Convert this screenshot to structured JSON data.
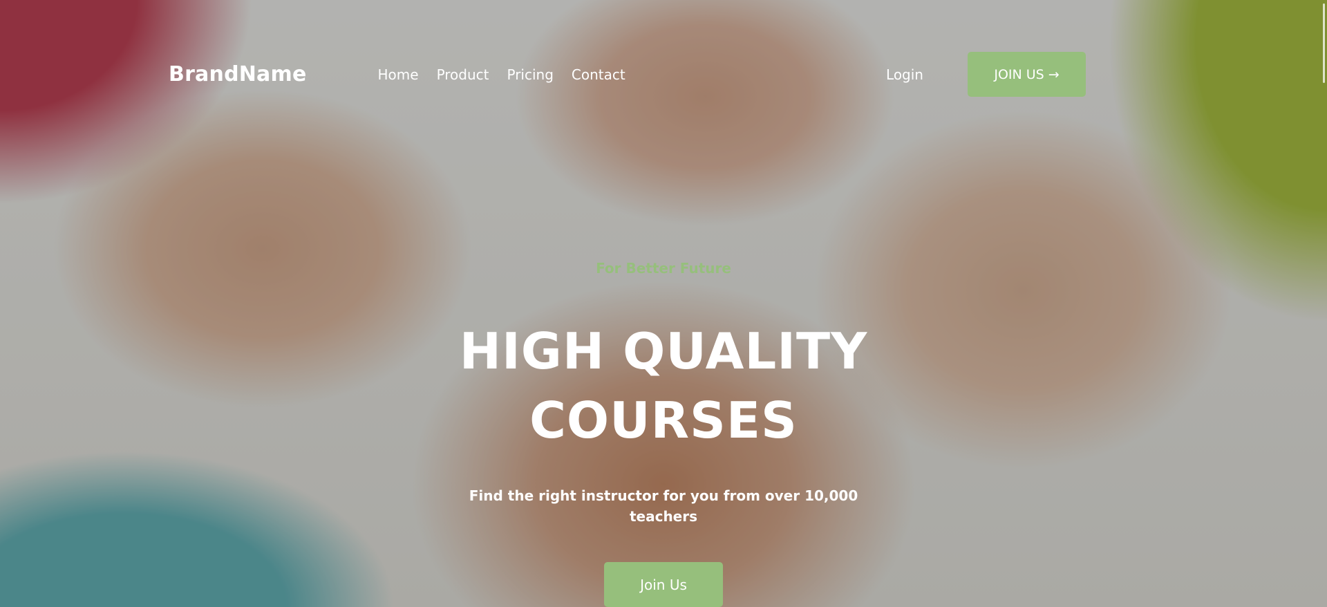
{
  "header": {
    "brand": "BrandName",
    "nav": [
      "Home",
      "Product",
      "Pricing",
      "Contact"
    ],
    "login_label": "Login",
    "join_label": "JOIN US",
    "join_icon": "arrow-right-icon"
  },
  "hero": {
    "tagline": "For Better Future",
    "headline_line1": "HIGH QUALITY",
    "headline_line2": "COURSES",
    "subtitle": "Find the right instructor for you from over 10,000 teachers",
    "cta_label": "Join Us"
  },
  "colors": {
    "accent": "#96bf7c",
    "text": "#ffffff"
  }
}
